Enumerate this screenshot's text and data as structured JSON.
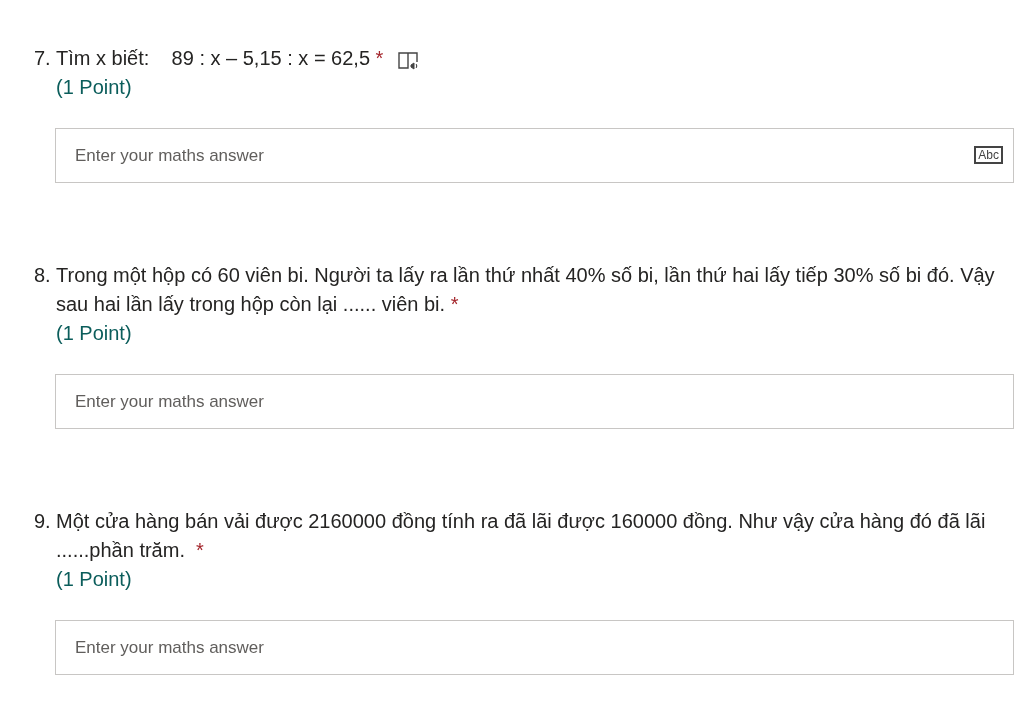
{
  "questions": [
    {
      "number": "7.",
      "text": "Tìm x biết:    89 : x – 5,15 : x = 62,5",
      "required_mark": "*",
      "reader_icon": true,
      "points": "(1 Point)",
      "placeholder": "Enter your maths answer",
      "badge": "Abc"
    },
    {
      "number": "8.",
      "text": "Trong một hộp có 60 viên bi. Người ta lấy ra lần thứ nhất 40% số bi, lần thứ hai lấy tiếp 30% số bi đó. Vậy sau hai lần lấy trong hộp còn lại ...... viên bi.",
      "required_mark": "*",
      "reader_icon": false,
      "points": "(1 Point)",
      "placeholder": "Enter your maths answer"
    },
    {
      "number": "9.",
      "text": "Một cửa hàng bán vải được 2160000 đồng tính ra đã lãi được 160000 đồng. Như vậy cửa hàng đó đã lãi ......phần trăm. ",
      "required_mark": "*",
      "reader_icon": false,
      "points": "(1 Point)",
      "placeholder": "Enter your maths answer"
    }
  ]
}
